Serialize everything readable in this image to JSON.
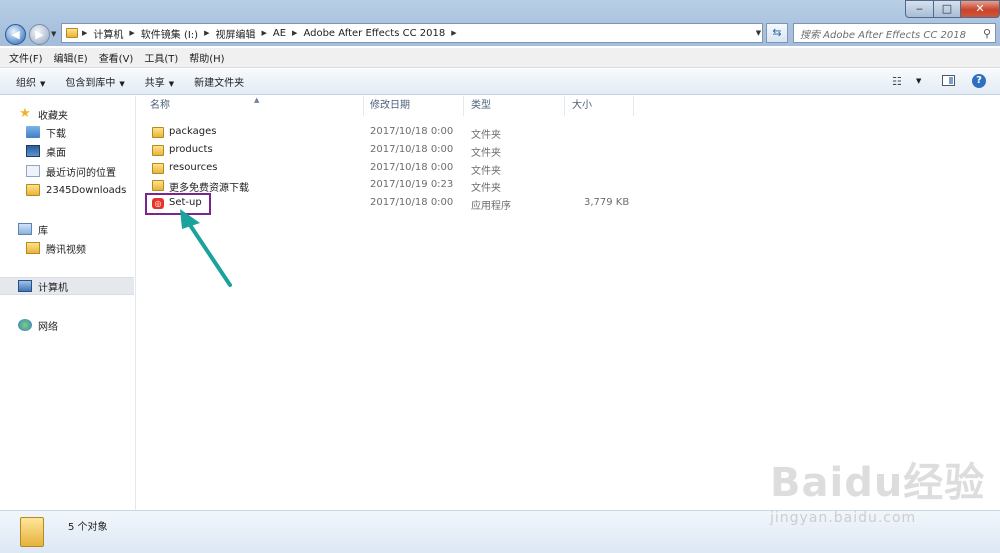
{
  "address": {
    "crumbs": [
      "计算机",
      "软件镜集 (I:)",
      "视屏编辑",
      "AE",
      "Adobe After Effects CC 2018"
    ]
  },
  "search": {
    "placeholder": "搜索 Adobe After Effects CC 2018"
  },
  "menu": [
    "文件(F)",
    "编辑(E)",
    "查看(V)",
    "工具(T)",
    "帮助(H)"
  ],
  "toolbar": {
    "organize": "组织",
    "include_library": "包含到库中",
    "share": "共享",
    "new_folder": "新建文件夹"
  },
  "nav": {
    "favorites": "收藏夹",
    "downloads": "下载",
    "desktop": "桌面",
    "recent": "最近访问的位置",
    "downloads2345": "2345Downloads",
    "libraries": "库",
    "tencent_video": "腾讯视频",
    "computer": "计算机",
    "network": "网络"
  },
  "columns": {
    "name": "名称",
    "modified": "修改日期",
    "type": "类型",
    "size": "大小"
  },
  "files": [
    {
      "name": "packages",
      "modified": "2017/10/18 0:00",
      "type": "文件夹",
      "size": ""
    },
    {
      "name": "products",
      "modified": "2017/10/18 0:00",
      "type": "文件夹",
      "size": ""
    },
    {
      "name": "resources",
      "modified": "2017/10/18 0:00",
      "type": "文件夹",
      "size": ""
    },
    {
      "name": "更多免费资源下载",
      "modified": "2017/10/19 0:23",
      "type": "文件夹",
      "size": ""
    },
    {
      "name": "Set-up",
      "modified": "2017/10/18 0:00",
      "type": "应用程序",
      "size": "3,779 KB"
    }
  ],
  "status": {
    "count": "5 个对象"
  },
  "watermark": {
    "logo": "Baidu经验",
    "url": "jingyan.baidu.com"
  },
  "colors": {
    "highlight_box": "#7a2590",
    "annotation_arrow": "#1aa39a"
  }
}
